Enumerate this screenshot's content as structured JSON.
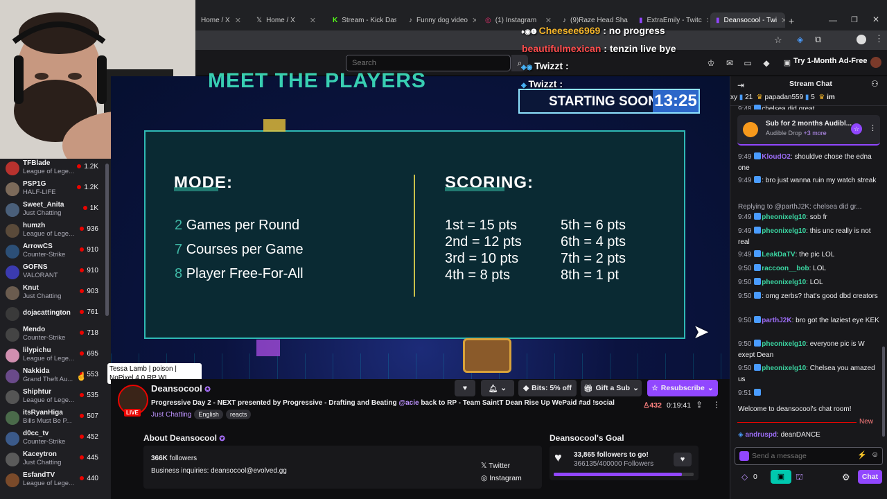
{
  "browser": {
    "tabs": [
      {
        "title": "Home / X"
      },
      {
        "title": "Home / X"
      },
      {
        "title": "Stream - Kick Das"
      },
      {
        "title": "Funny dog video"
      },
      {
        "title": "(1) Instagram"
      },
      {
        "title": "(9)Raze Head Sha"
      },
      {
        "title": "ExtraEmily - Twitc"
      },
      {
        "title": "Deansocool - Twi"
      }
    ]
  },
  "nav": {
    "search_placeholder": "Search",
    "adfree_label": "Try 1-Month Ad-Free"
  },
  "sidebar": {
    "channels": [
      {
        "name": "TFBlade",
        "game": "League of Lege...",
        "viewers": "1.2K",
        "color": "#b8322e"
      },
      {
        "name": "PSP1G",
        "game": "HALF-LIFE",
        "viewers": "1.2K",
        "color": "#7c6a5a"
      },
      {
        "name": "Sweet_Anita",
        "game": "Just Chatting",
        "viewers": "1K",
        "color": "#4a5f7a"
      },
      {
        "name": "humzh",
        "game": "League of Lege...",
        "viewers": "936",
        "color": "#5a4a3a"
      },
      {
        "name": "ArrowCS",
        "game": "Counter-Strike",
        "viewers": "910",
        "color": "#2c4f77"
      },
      {
        "name": "GOFNS",
        "game": "VALORANT",
        "viewers": "910",
        "color": "#3b3bb0"
      },
      {
        "name": "Knut",
        "game": "Just Chatting",
        "viewers": "903",
        "color": "#6b5c4f"
      },
      {
        "name": "dojacattington",
        "game": "",
        "viewers": "761",
        "color": "#3a3a3a"
      },
      {
        "name": "Mendo",
        "game": "Counter-Strike",
        "viewers": "718",
        "color": "#444"
      },
      {
        "name": "lilypichu",
        "game": "League of Lege...",
        "viewers": "695",
        "color": "#d18fb0"
      },
      {
        "name": "Nakkida",
        "game": "Grand Theft Au...",
        "viewers": "553",
        "color": "#6a4a8a"
      },
      {
        "name": "Shiphtur",
        "game": "League of Lege...",
        "viewers": "535",
        "color": "#555"
      },
      {
        "name": "itsRyanHiga",
        "game": "Bills Must Be P...",
        "viewers": "507",
        "color": "#4a6a4a"
      },
      {
        "name": "d0cc_tv",
        "game": "Counter-Strike",
        "viewers": "452",
        "color": "#3b5a8a"
      },
      {
        "name": "Kaceytron",
        "game": "Just Chatting",
        "viewers": "445",
        "color": "#5a5a5a"
      },
      {
        "name": "EsfandTV",
        "game": "League of Lege...",
        "viewers": "440",
        "color": "#7a4a2a"
      }
    ],
    "tooltip": "Tessa Lamb | poison | NoPixel 4.0 RP WL"
  },
  "video": {
    "header": "MEET THE PLAYERS",
    "starting_label": "STARTING SOON!",
    "timer": "13:25",
    "mode_title": "MODE:",
    "mode_items": [
      {
        "num": "2",
        "text": "Games per Round"
      },
      {
        "num": "7",
        "text": "Courses per Game"
      },
      {
        "num": "8",
        "text": "Player Free-For-All"
      }
    ],
    "scoring_title": "SCORING:",
    "scoring_left": [
      "1st = 15 pts",
      "2nd = 12 pts",
      "3rd = 10 pts",
      "4th = 8 pts"
    ],
    "scoring_right": [
      "5th = 6 pts",
      "6th = 4 pts",
      "7th = 2 pts",
      "8th = 1 pt"
    ],
    "overlay_chat": [
      {
        "user": "Cheesee6969",
        "msg": " : no progress",
        "color": "#f5b52a"
      },
      {
        "user": "beautifulmexican",
        "msg": " : tenzin live bye",
        "color": "#ff4d4d"
      },
      {
        "user": "Twizzt",
        "msg": " :",
        "color": "#ffffff"
      },
      {
        "user": "Twizzt",
        "msg": " :",
        "color": "#ffffff"
      }
    ]
  },
  "channel": {
    "name": "Deansocool",
    "title": "Progressive Day 2 - NEXT presented by Progressive - Drafting and Beating ",
    "mention": "@acie",
    "title_rest": " back to RP - Team SaintT Dean Rise Up WePaid #ad !social",
    "category": "Just Chatting",
    "tags": [
      "English",
      "reacts"
    ],
    "live": "LIVE",
    "viewers": "432",
    "uptime": "0:19:41",
    "bits_label": "Bits: 5% off",
    "gift_label": "Gift a Sub",
    "resub_label": "Resubscribe",
    "about_title": "About Deansocool",
    "followers": "366K",
    "followers_label": "followers",
    "business": "Business inquiries: deansocool@evolved.gg",
    "socials": [
      "Twitter",
      "Instagram"
    ],
    "goal_title": "Deansocool's Goal",
    "goal_line": "33,865 followers to go!",
    "goal_progress": "366135/400000 Followers",
    "goal_fraction": 0.915
  },
  "chat": {
    "header": "Stream Chat",
    "leaderboard": [
      {
        "name": "xy",
        "count": "21"
      },
      {
        "name": "papadan559",
        "count": "5"
      },
      {
        "name": "im",
        "count": ""
      }
    ],
    "ad_title": "Sub for 2 months Audibl...",
    "ad_sub": "Audible Drop",
    "ad_more": "+3 more",
    "messages": [
      {
        "time": "9:48",
        "user": "",
        "color": "#adadb8",
        "text": "chelsea did great"
      },
      {
        "time": "9:49",
        "user": "KloudO2",
        "color": "#9b6cf5",
        "text": ": shouldve chose the edna one"
      },
      {
        "time": "9:49",
        "user": "",
        "color": "#adadb8",
        "text": ": bro just wanna ruin my watch streak"
      },
      {
        "time": "",
        "user": "",
        "color": "#adadb8",
        "text": "Replying to @parthJ2K: chelsea did gr..."
      },
      {
        "time": "9:49",
        "user": "pheonixelg10",
        "color": "#3bd6a2",
        "text": ": sob fr"
      },
      {
        "time": "9:49",
        "user": "pheonixelg10",
        "color": "#3bd6a2",
        "text": ": this unc really is not real"
      },
      {
        "time": "9:49",
        "user": "LeakDaTV",
        "color": "#3bd6a2",
        "text": ": the pic LOL"
      },
      {
        "time": "9:50",
        "user": "raccoon__bob",
        "color": "#3bd6a2",
        "text": ": LOL"
      },
      {
        "time": "9:50",
        "user": "pheonixelg10",
        "color": "#3bd6a2",
        "text": ": LOL"
      },
      {
        "time": "9:50",
        "user": "",
        "color": "#adadb8",
        "text": ": omg zerbs? that's good dbd creators"
      },
      {
        "time": "9:50",
        "user": "parthJ2K",
        "color": "#9b6cf5",
        "text": ": bro got the laziest eye KEK"
      },
      {
        "time": "9:50",
        "user": "pheonixelg10",
        "color": "#3bd6a2",
        "text": ": everyone pic is W exept Dean"
      },
      {
        "time": "9:50",
        "user": "pheonixelg10",
        "color": "#3bd6a2",
        "text": ": Chelsea you amazed us"
      },
      {
        "time": "9:51",
        "user": "",
        "color": "#adadb8",
        "text": ""
      },
      {
        "time": "",
        "user": "",
        "color": "#efeff1",
        "text": "Welcome to deansocool's chat room!"
      }
    ],
    "new_label": "New",
    "last_msg": {
      "user": "andruspd",
      "text": ": deanDANCE"
    },
    "input_placeholder": "Send a message",
    "points": "0",
    "chat_btn": "Chat"
  }
}
